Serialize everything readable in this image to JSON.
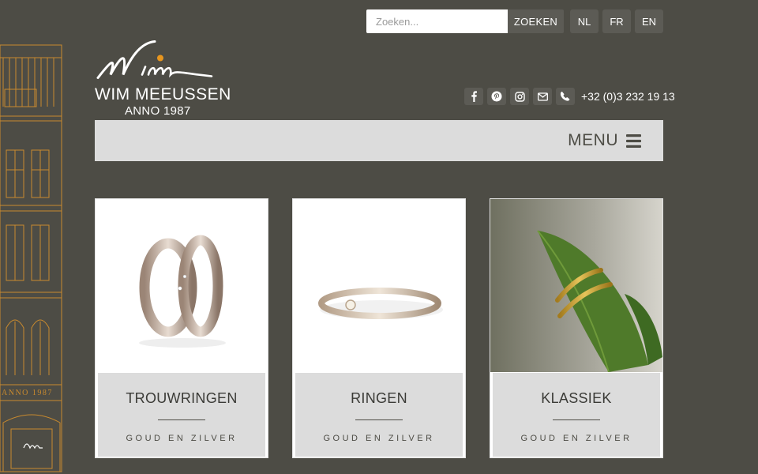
{
  "header": {
    "search": {
      "placeholder": "Zoeken...",
      "button_label": "ZOEKEN"
    },
    "languages": [
      "NL",
      "FR",
      "EN"
    ]
  },
  "brand": {
    "name": "WIM MEEUSSEN",
    "tagline": "ANNO 1987",
    "facade_text": "ANNO 1987",
    "accent_color": "#e8961e"
  },
  "contact": {
    "icons": [
      "facebook-icon",
      "pinterest-icon",
      "instagram-icon",
      "mail-icon",
      "phone-icon"
    ],
    "phone": "+32 (0)3 232 19 13"
  },
  "nav": {
    "menu_label": "MENU"
  },
  "categories": [
    {
      "title": "TROUWRINGEN",
      "subtitle": "GOUD EN ZILVER"
    },
    {
      "title": "RINGEN",
      "subtitle": "GOUD EN ZILVER"
    },
    {
      "title": "KLASSIEK",
      "subtitle": "GOUD EN ZILVER"
    }
  ],
  "colors": {
    "background": "#4d4c45",
    "menu_bar": "#dcdcdc",
    "button": "#5c5b55",
    "facade_lines": "#c98a2e"
  }
}
